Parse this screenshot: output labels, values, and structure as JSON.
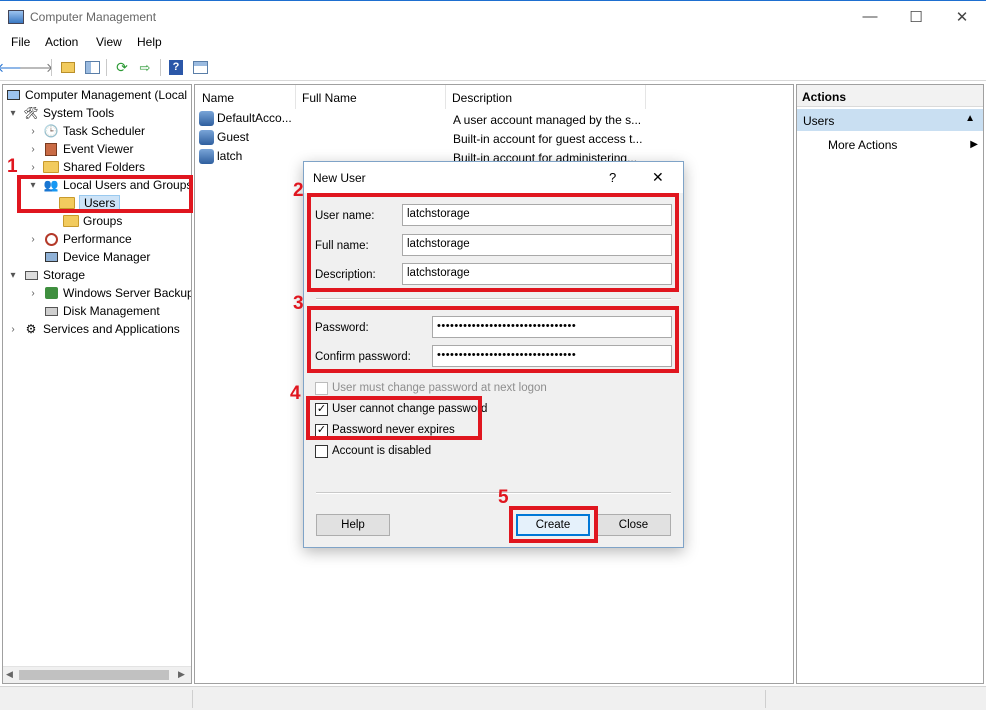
{
  "window": {
    "title": "Computer Management",
    "controls": [
      "—",
      "☐",
      "✕"
    ]
  },
  "menu": [
    "File",
    "Action",
    "View",
    "Help"
  ],
  "tree": {
    "root": "Computer Management (Local",
    "system_tools": "System Tools",
    "task_scheduler": "Task Scheduler",
    "event_viewer": "Event Viewer",
    "shared_folders": "Shared Folders",
    "local_users_groups": "Local Users and Groups",
    "users": "Users",
    "groups": "Groups",
    "performance": "Performance",
    "device_manager": "Device Manager",
    "storage": "Storage",
    "windows_server_backup": "Windows Server Backup",
    "disk_management": "Disk Management",
    "services_apps": "Services and Applications"
  },
  "list": {
    "columns": [
      "Name",
      "Full Name",
      "Description"
    ],
    "rows": [
      {
        "name": "DefaultAcco...",
        "full_name": "",
        "description": "A user account managed by the s..."
      },
      {
        "name": "Guest",
        "full_name": "",
        "description": "Built-in account for guest access t..."
      },
      {
        "name": "latch",
        "full_name": "",
        "description": "Built-in account for administering..."
      }
    ]
  },
  "actions": {
    "title": "Actions",
    "section": "Users",
    "more_actions": "More Actions"
  },
  "dialog": {
    "title": "New User",
    "help_glyph": "?",
    "close_glyph": "✕",
    "user_name_label": "User name:",
    "user_name_value": "latchstorage",
    "full_name_label": "Full name:",
    "full_name_value": "latchstorage",
    "description_label": "Description:",
    "description_value": "latchstorage",
    "password_label": "Password:",
    "password_value": "••••••••••••••••••••••••••••••••",
    "confirm_label": "Confirm password:",
    "confirm_value": "••••••••••••••••••••••••••••••••",
    "chk_must_change": "User must change password at next logon",
    "chk_cannot_change": "User cannot change password",
    "chk_never_expires": "Password never expires",
    "chk_disabled": "Account is disabled",
    "must_change_checked": false,
    "cannot_change_checked": true,
    "never_expires_checked": true,
    "disabled_checked": false,
    "help_btn": "Help",
    "create_btn": "Create",
    "close_btn": "Close"
  },
  "annotations": [
    "1",
    "2",
    "3",
    "4",
    "5"
  ],
  "colors": {
    "callout_red": "#e0161f",
    "selection_blue": "#cde3f7",
    "actions_section": "#c9dff2",
    "default_button_border": "#0078d7"
  }
}
